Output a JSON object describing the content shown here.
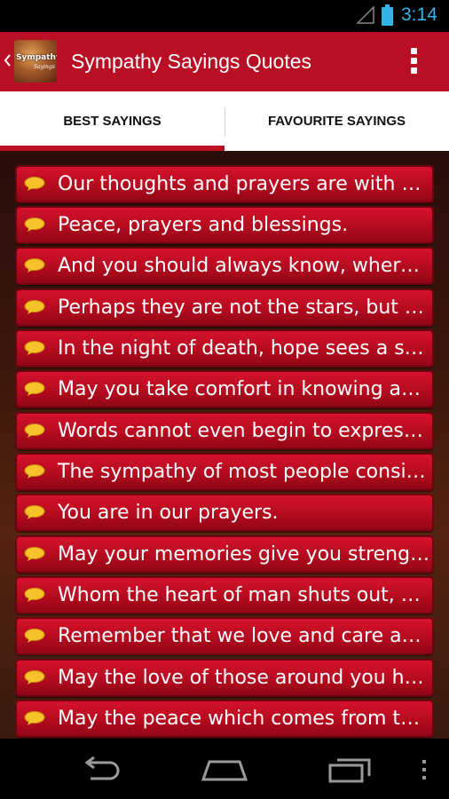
{
  "status_bar": {
    "time": "3:14",
    "signal_icon": "signal-icon",
    "battery_icon": "battery-icon",
    "accent_color": "#33b5e5"
  },
  "action_bar": {
    "title": "Sympathy Sayings Quotes",
    "app_icon_text": "Sympathy",
    "app_icon_subtext": "Sayings",
    "color": "#b80f24"
  },
  "tabs": [
    {
      "label": "BEST SAYINGS",
      "selected": true
    },
    {
      "label": "FAVOURITE SAYINGS",
      "selected": false
    }
  ],
  "sayings": [
    "Our thoughts and prayers are with you at this difficult time.",
    "Peace, prayers and blessings.",
    "And you should always know, wherever you may go.",
    "Perhaps they are not the stars, but rather openings in heaven.",
    "In the night of death, hope sees a star.",
    "May you take comfort in knowing and remembering.",
    "Words cannot even begin to express our sorrow.",
    "The sympathy of most people consists of a prying interest.",
    "You are in our prayers.",
    "May your memories give you strength.",
    "Whom the heart of man shuts out, Sometimes the heart of God takes in.",
    "Remember that we love and care about you.",
    "May the love of those around you help you.",
    "May the peace which comes from the memories of love shared comfort you."
  ],
  "nav_bar": {
    "back_icon": "back-icon",
    "home_icon": "home-icon",
    "recents_icon": "recents-icon",
    "menu_icon": "menu-icon"
  }
}
